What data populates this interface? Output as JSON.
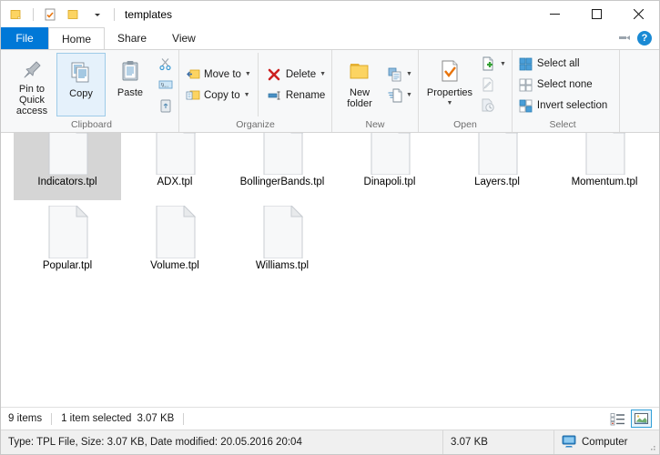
{
  "window": {
    "title": "templates",
    "quick_access": [
      {
        "name": "folder-icon",
        "label": "Folder"
      },
      {
        "name": "properties-icon",
        "label": "Properties"
      },
      {
        "name": "new-folder-icon",
        "label": "New folder"
      }
    ],
    "customize_qat_label": "Customize Quick Access Toolbar",
    "controls": {
      "minimize": "Minimize",
      "maximize": "Maximize",
      "close": "Close"
    }
  },
  "ribbon": {
    "tabs": [
      {
        "label": "File",
        "id": "file"
      },
      {
        "label": "Home",
        "id": "home"
      },
      {
        "label": "Share",
        "id": "share"
      },
      {
        "label": "View",
        "id": "view"
      }
    ],
    "active_tab": "Home",
    "collapse_label": "Collapse the Ribbon",
    "help_label": "?",
    "groups": [
      {
        "label": "Clipboard",
        "buttons": {
          "pin": "Pin to Quick\naccess",
          "pin_line1": "Pin to Quick",
          "pin_line2": "access",
          "copy": "Copy",
          "paste": "Paste",
          "cut": "Cut",
          "copy_path": "Copy path",
          "paste_shortcut": "Paste shortcut"
        }
      },
      {
        "label": "Organize",
        "buttons": {
          "move_to": "Move to",
          "copy_to": "Copy to",
          "delete": "Delete",
          "rename": "Rename"
        }
      },
      {
        "label": "New",
        "buttons": {
          "new_folder_line1": "New",
          "new_folder_line2": "folder",
          "easy_access": "Easy access",
          "new_item": "New item"
        }
      },
      {
        "label": "Open",
        "buttons": {
          "properties": "Properties",
          "open": "Open",
          "edit": "Edit",
          "history": "History"
        }
      },
      {
        "label": "Select",
        "buttons": {
          "select_all": "Select all",
          "select_none": "Select none",
          "invert_selection": "Invert selection"
        }
      }
    ]
  },
  "files": [
    {
      "name": "Indicators.tpl",
      "selected": true
    },
    {
      "name": "ADX.tpl",
      "selected": false
    },
    {
      "name": "BollingerBands.tpl",
      "selected": false
    },
    {
      "name": "Dinapoli.tpl",
      "selected": false
    },
    {
      "name": "Layers.tpl",
      "selected": false
    },
    {
      "name": "Momentum.tpl",
      "selected": false
    },
    {
      "name": "Popular.tpl",
      "selected": false
    },
    {
      "name": "Volume.tpl",
      "selected": false
    },
    {
      "name": "Williams.tpl",
      "selected": false
    }
  ],
  "status": {
    "item_count": "9 items",
    "selection": "1 item selected",
    "selection_size": "3.07 KB",
    "view_details_label": "Details view",
    "view_large_icons_label": "Large icons view"
  },
  "details": {
    "info": "Type: TPL File, Size: 3.07 KB, Date modified: 20.05.2016 20:04",
    "size": "3.07 KB",
    "location": "Computer"
  }
}
